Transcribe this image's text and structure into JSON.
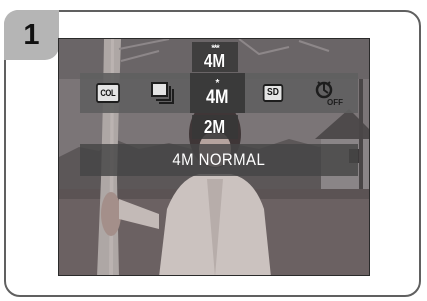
{
  "step": {
    "number": "1"
  },
  "resolution_options": {
    "above": {
      "stars": "***",
      "label": "4M"
    },
    "selected": {
      "stars": "*",
      "label": "4M"
    },
    "below": {
      "label": "2M"
    }
  },
  "menu": {
    "items": [
      {
        "name": "color-mode",
        "label": "COL",
        "icon": "color-mode-icon"
      },
      {
        "name": "drive-mode",
        "icon": "continuous-drive-icon"
      },
      {
        "name": "image-size",
        "icon": "image-size-icon",
        "active": true
      },
      {
        "name": "media",
        "label": "SD",
        "icon": "sd-card-icon"
      },
      {
        "name": "self-timer",
        "label": "OFF",
        "icon": "self-timer-off-icon"
      }
    ]
  },
  "status": {
    "text": "4M NORMAL"
  },
  "colors": {
    "menu_bar": "#5f5f5f",
    "active_item": "#3a3a3a",
    "tab": "#b5b5b5",
    "frame_border": "#606060"
  }
}
